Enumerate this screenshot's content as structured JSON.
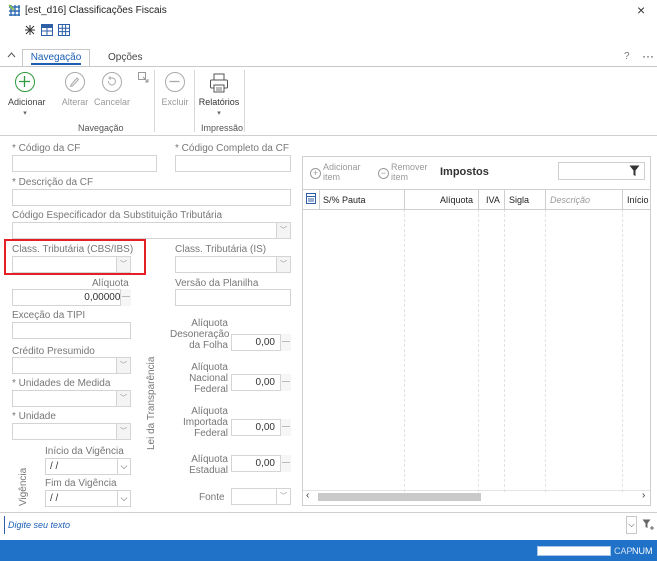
{
  "window": {
    "title": "[est_d16]  Classificações Fiscais",
    "close": "×"
  },
  "ribbon": {
    "tabs": [
      {
        "label": "Navegação",
        "active": true
      },
      {
        "label": "Opções",
        "active": false
      }
    ],
    "help": "?",
    "more": "···",
    "buttons": {
      "adicionar": "Adicionar",
      "alterar": "Alterar",
      "cancelar": "Cancelar",
      "excluir": "Excluir",
      "relatorios": "Relatórios"
    },
    "groups": {
      "navegacao": "Navegação",
      "impressao": "Impressão"
    }
  },
  "form": {
    "codigo_cf": "* Código da CF",
    "codigo_completo_cf": "* Código Completo da CF",
    "descricao_cf": "* Descrição da CF",
    "cest": "Código Especificador da Substituição  Tributária",
    "class_cbs_ibs": "Class. Tributária (CBS/IBS)",
    "class_is": "Class. Tributária (IS)",
    "aliquota_label": "Alíquota",
    "aliquota_value": "0,000000",
    "versao_planilha": "Versão da Planilha",
    "excecao_tipi": "Exceção da TIPI",
    "credito_presumido": "Crédito Presumido",
    "unidades_medida": "* Unidades de Medida",
    "unidade": "* Unidade",
    "vigencia_group": "Vigência",
    "inicio_vigencia": "Início da Vigência",
    "inicio_value": " / /",
    "fim_vigencia": "Fim da Vigência",
    "fim_value": " / /",
    "transparencia_group": "Lei da Transparência",
    "aliq_desoneracao": [
      "Alíquota",
      "Desoneração",
      "da Folha"
    ],
    "aliq_desoneracao_value": "0,00",
    "aliq_nacional": [
      "Alíquota",
      "Nacional",
      "Federal"
    ],
    "aliq_nacional_value": "0,00",
    "aliq_importada": [
      "Alíquota",
      "Importada",
      "Federal"
    ],
    "aliq_importada_value": "0,00",
    "aliq_estadual": [
      "Alíquota",
      "Estadual"
    ],
    "aliq_estadual_value": "0,00",
    "fonte": "Fonte"
  },
  "impostos": {
    "title": "Impostos",
    "add_item": [
      "Adicionar",
      "item"
    ],
    "remove_item": [
      "Remover",
      "item"
    ],
    "columns": {
      "pauta": "S/% Pauta",
      "aliquota": "Alíquota",
      "iva": "IVA",
      "sigla": "Sigla",
      "descricao": "Descrição",
      "inicio": "Início"
    }
  },
  "bottom": {
    "placeholder": "Digite seu texto"
  },
  "status": {
    "cap": "CAP",
    "num": "NUM"
  }
}
